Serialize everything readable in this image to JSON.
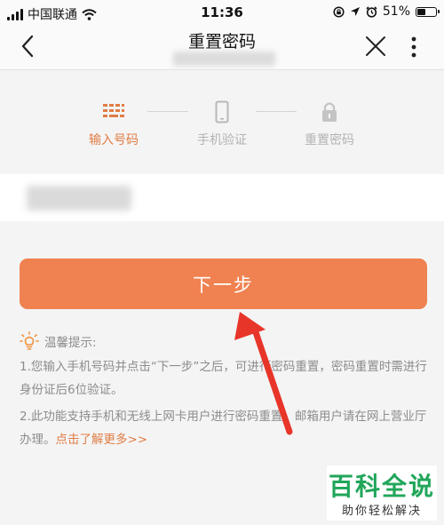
{
  "status_bar": {
    "carrier": "中国联通",
    "time": "11:36",
    "battery_text": "51%",
    "battery_level": 0.51,
    "icons": [
      "signal-icon",
      "wifi-icon",
      "lock-rotation-icon",
      "location-icon",
      "alarm-icon",
      "battery-icon"
    ]
  },
  "nav": {
    "title": "重置密码",
    "icons": [
      "back-chevron-icon",
      "close-icon",
      "more-vertical-icon"
    ]
  },
  "steps": [
    {
      "label": "输入号码",
      "icon": "keypad-icon",
      "active": true
    },
    {
      "label": "手机验证",
      "icon": "phone-icon",
      "active": false
    },
    {
      "label": "重置密码",
      "icon": "lock-icon",
      "active": false
    }
  ],
  "actions": {
    "next_label": "下一步"
  },
  "tips": {
    "heading": "温馨提示:",
    "line1": "1.您输入手机号码并点击“下一步”之后，可进行密码重置，密码重置时需进行身份证后6位验证。",
    "line2": "2.此功能支持手机和无线上网卡用户进行密码重置，邮箱用户请在网上营业厅办理。",
    "link": "点击了解更多>>",
    "icon": "lightbulb-icon"
  },
  "watermark": {
    "title": "百科全说",
    "subtitle": "助你轻松解决"
  },
  "colors": {
    "accent": "#ef8250",
    "accent_text": "#e07c44",
    "muted": "#b3b3b3",
    "annotation_arrow": "#e8352a",
    "watermark": "#21a65a"
  }
}
